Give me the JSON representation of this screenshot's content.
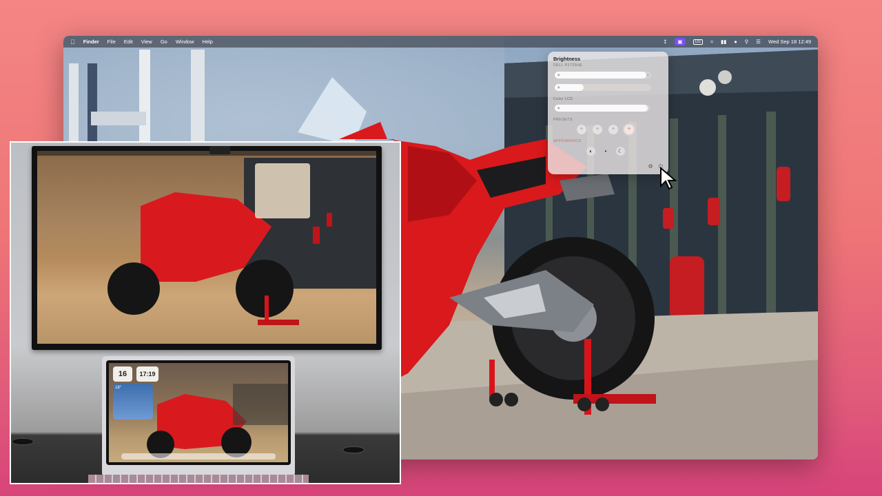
{
  "menubar": {
    "app_name": "Finder",
    "menus": [
      "File",
      "Edit",
      "View",
      "Go",
      "Window",
      "Help"
    ],
    "keyboard_layout": "US",
    "datetime": "Wed Sep 18  12:49"
  },
  "brightness_panel": {
    "title": "Brightness",
    "display1_label": "DELL P2725HE",
    "display1_level": 0.95,
    "display1_secondary_level": 0.3,
    "display2_label": "Color LCD",
    "display2_level": 0.98,
    "presets_label": "PRESETS",
    "presets_selected_index": 3,
    "appearance_label": "APPEARANCE"
  },
  "laptop_widgets": {
    "date_widget": "16",
    "time_widget": "17:19",
    "weather_temp": "18°"
  },
  "colors": {
    "background_top": "#f48585",
    "background_bottom": "#d8447a",
    "accent_pill": "#7b4ff0",
    "motorcycle_red": "#d9191c"
  }
}
